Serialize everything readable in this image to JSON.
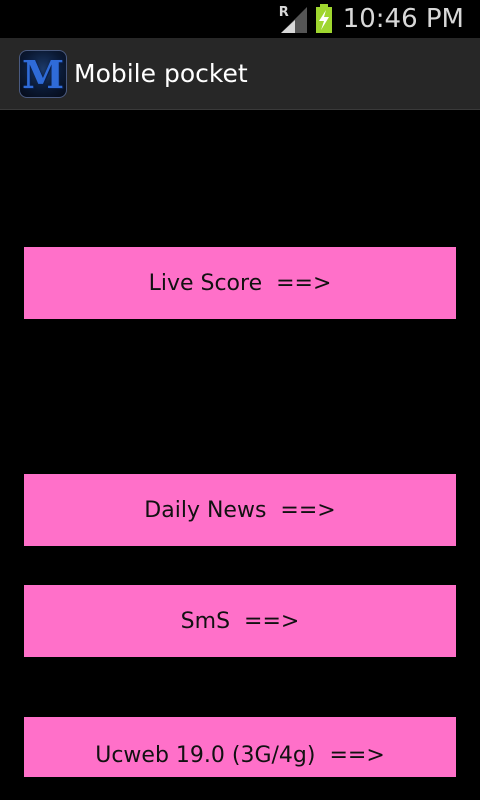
{
  "status_bar": {
    "signal_label": "R",
    "time": "10:46 PM",
    "battery_state": "charging",
    "battery_color": "#9fd62f"
  },
  "action_bar": {
    "title": "Mobile pocket",
    "app_icon_letter": "M",
    "icon_name": "app-logo-icon"
  },
  "menu": {
    "accent_color": "#ff70c9",
    "items": [
      {
        "label": "Live Score  ==>"
      },
      {
        "label": "Daily News  ==>"
      },
      {
        "label": "SmS  ==>"
      },
      {
        "label": "Ucweb 19.0 (3G/4g)  ==>"
      }
    ]
  }
}
